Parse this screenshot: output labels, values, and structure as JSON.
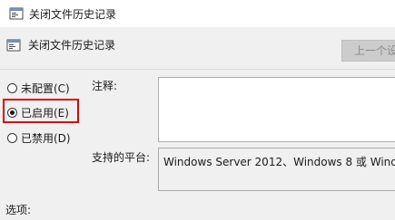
{
  "window": {
    "title": "关闭文件历史记录"
  },
  "header": {
    "title": "关闭文件历史记录",
    "prev_button": "上一个设"
  },
  "radios": [
    {
      "label": "未配置(C)",
      "checked": false
    },
    {
      "label": "已启用(E)",
      "checked": true
    },
    {
      "label": "已禁用(D)",
      "checked": false
    }
  ],
  "comment": {
    "label": "注释:",
    "value": ""
  },
  "supported": {
    "label": "支持的平台:",
    "value": "Windows Server 2012、Windows 8 或 Windo"
  },
  "options": {
    "label": "选项:"
  },
  "colors": {
    "highlight": "#e50000",
    "background": "#f0f0f0"
  },
  "icons": {
    "app": "policy-settings-icon",
    "header": "policy-settings-icon"
  }
}
